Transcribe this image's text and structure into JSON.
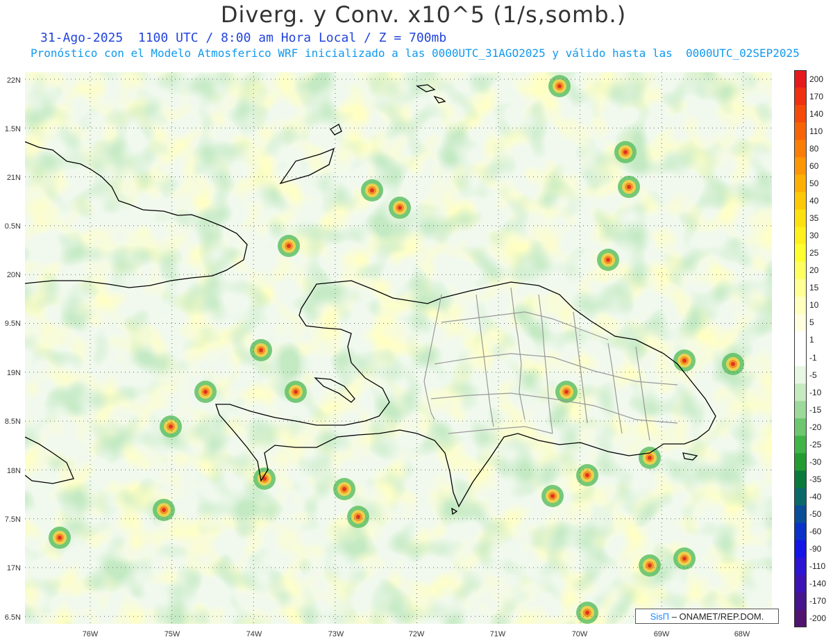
{
  "header": {
    "title": "Diverg. y Conv. x10^5 (1/s,somb.)",
    "subtitle": "31-Ago-2025  1100 UTC / 8:00 am Hora Local / Z = 700mb",
    "description": "Pronóstico con el Modelo Atmosferico WRF inicializado a las 0000UTC_31AGO2025 y válido hasta las  0000UTC_02SEP2025"
  },
  "axes": {
    "lat_labels": [
      "22N",
      "1.5N",
      "21N",
      "0.5N",
      "20N",
      "9.5N",
      "19N",
      "8.5N",
      "18N",
      "7.5N",
      "17N",
      "6.5N"
    ],
    "lon_labels": [
      "76W",
      "75W",
      "74W",
      "73W",
      "72W",
      "71W",
      "70W",
      "69W",
      "68W"
    ]
  },
  "colorbar": {
    "labels": [
      "200",
      "170",
      "140",
      "110",
      "80",
      "60",
      "50",
      "40",
      "35",
      "30",
      "25",
      "20",
      "15",
      "10",
      "5",
      "1",
      "-1",
      "-5",
      "-10",
      "-15",
      "-20",
      "-25",
      "-30",
      "-35",
      "-40",
      "-50",
      "-60",
      "-90",
      "-110",
      "-140",
      "-170",
      "-200"
    ],
    "colors": [
      "#e41a1c",
      "#f03010",
      "#f44a0a",
      "#f76408",
      "#fa7d06",
      "#fc9604",
      "#fdaf04",
      "#fdc806",
      "#fde010",
      "#fff01e",
      "#ffff30",
      "#ffff62",
      "#ffff94",
      "#ffffbe",
      "#ffffe0",
      "#ffffff",
      "#ffffff",
      "#e8f6e4",
      "#c6eac0",
      "#9cd99a",
      "#6cc76e",
      "#41b448",
      "#229c31",
      "#0a7a3c",
      "#0a6a6a",
      "#0a4e9a",
      "#0a32c8",
      "#1414e6",
      "#2d14d2",
      "#3c14b4",
      "#46148c",
      "#50146e"
    ]
  },
  "credit": {
    "brand": "SisΠ",
    "text": " – ONAMET/REP.DOM."
  }
}
